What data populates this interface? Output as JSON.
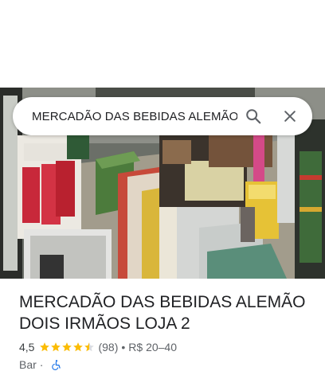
{
  "search": {
    "query": "MERCADÃO DAS BEBIDAS ALEMÃO",
    "search_icon": "search-icon",
    "close_icon": "close-icon"
  },
  "place": {
    "name": "MERCADÃO DAS BEBIDAS ALEMÃO DOIS IRMÃOS LOJA 2",
    "rating": "4,5",
    "rating_stars": 4.5,
    "review_count": "(98)",
    "separator": "•",
    "price_range": "R$ 20–40",
    "category": "Bar",
    "category_separator": "·",
    "accessibility_icon": "wheelchair-icon"
  },
  "colors": {
    "star": "#fbbc04",
    "star_empty": "#dadce0",
    "accessibility": "#1a73e8",
    "text_primary": "#202124",
    "text_secondary": "#5f6368"
  }
}
